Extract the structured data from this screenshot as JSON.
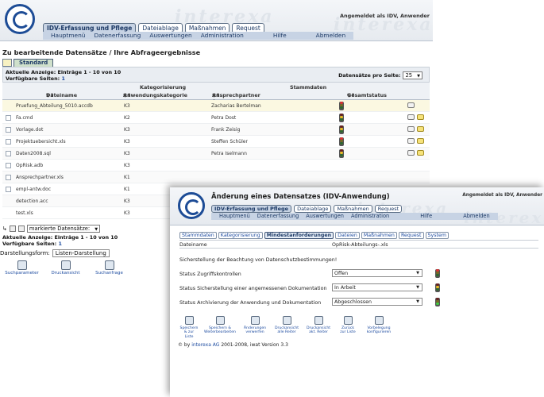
{
  "watermark": "interexa",
  "back": {
    "app_tabs": [
      "IDV-Erfassung und Pflege",
      "Dateiablage",
      "Maßnahmen",
      "Request"
    ],
    "menu": [
      "Hauptmenü",
      "Datenerfassung",
      "Auswertungen",
      "Administration",
      "Hilfe",
      "Abmelden"
    ],
    "login": "Angemeldet als IDV, Anwender",
    "title": "Zu bearbeitende Datensätze / Ihre Abfrageergebnisse",
    "view_tab": "Standard",
    "anzeige": "Aktuelle Anzeige: Einträge 1 - 10 von 10",
    "seiten_label": "Verfügbare Seiten:",
    "seiten_value": "1",
    "per_page_label": "Datensätze pro Seite:",
    "per_page_value": "25",
    "col_group_kat": "Kategorisierung",
    "col_group_stamm": "Stammdaten",
    "columns": [
      "Dateiname",
      "Anwendungskategorie",
      "Ansprechpartner Anwendung",
      "Gesamtstatus"
    ],
    "rows": [
      {
        "name": "Pruefung_Abteilung_5010.accdb",
        "kat": "K3",
        "person": "Zacharias Bertelman",
        "checkbox": false
      },
      {
        "name": "Fa.cmd",
        "kat": "K2",
        "person": "Petra Dost",
        "checkbox": true
      },
      {
        "name": "Vorlage.dot",
        "kat": "K3",
        "person": "Frank Zeisig",
        "checkbox": true
      },
      {
        "name": "Projektuebersicht.xls",
        "kat": "K3",
        "person": "Steffen Schüler",
        "checkbox": true
      },
      {
        "name": "Daten2008.sql",
        "kat": "K3",
        "person": "Petra Iselmann",
        "checkbox": true
      },
      {
        "name": "OpRisk.adb",
        "kat": "K3",
        "person": "",
        "checkbox": true
      },
      {
        "name": "Ansprechpartner.xls",
        "kat": "K1",
        "person": "",
        "checkbox": true
      },
      {
        "name": "empl-antw.doc",
        "kat": "K1",
        "person": "",
        "checkbox": true
      },
      {
        "name": "detection.acc",
        "kat": "K3",
        "person": "",
        "checkbox": false
      },
      {
        "name": "test.xls",
        "kat": "K3",
        "person": "",
        "checkbox": false
      }
    ],
    "bulk_select": "markierte Datensätze:",
    "footer_anzeige": "Aktuelle Anzeige: Einträge 1 - 10 von 10",
    "footer_seiten_label": "Verfügbare Seiten:",
    "footer_seiten_value": "1",
    "darstellung_label": "Darstellungsform:",
    "darstellung_value": "Listen-Darstellung",
    "tools": [
      "Suchparameter",
      "Druckansicht",
      "Suchanfrage"
    ]
  },
  "front": {
    "title": "Änderung eines Datensatzes (IDV-Anwendung)",
    "login": "Angemeldet als IDV, Anwender",
    "app_tabs": [
      "IDV-Erfassung und Pflege",
      "Dateiablage",
      "Maßnahmen",
      "Request"
    ],
    "menu": [
      "Hauptmenü",
      "Datenerfassung",
      "Auswertungen",
      "Administration",
      "Hilfe",
      "Abmelden"
    ],
    "subtabs": [
      "Stammdaten",
      "Kategorisierung",
      "Mindestanforderungen",
      "Dateien",
      "Maßnahmen",
      "Request",
      "System"
    ],
    "active_subtab": "Mindestanforderungen",
    "dateiname_label": "Dateiname",
    "dateiname_value": "OpRisk-Abteilungs-.xls",
    "hint": "Sicherstellung der Beachtung von Datenschutzbestimmungen!",
    "fields": [
      {
        "label": "Status Zugriffskontrollen",
        "value": "Offen"
      },
      {
        "label": "Status Sicherstellung einer angemessenen Dokumentation",
        "value": "In Arbeit"
      },
      {
        "label": "Status Archivierung der Anwendung und Dokumentation",
        "value": "Abgeschlossen"
      }
    ],
    "toolbar": [
      [
        "Speichern",
        "& zur",
        "Liste"
      ],
      [
        "Speichern &",
        "Weiterbearbeiten"
      ],
      [
        "Änderungen",
        "verwerfen"
      ],
      [
        "Druckansicht",
        "alle Reiter"
      ],
      [
        "Druckansicht",
        "akt. Reiter"
      ],
      [
        "Zurück",
        "zur Liste"
      ],
      [
        "Vorbelegung",
        "konfigurieren"
      ]
    ],
    "copyright_prefix": "© by",
    "copyright_link": "interexa AG",
    "copyright_suffix": "2001-2008, iwat Version 3.3"
  }
}
